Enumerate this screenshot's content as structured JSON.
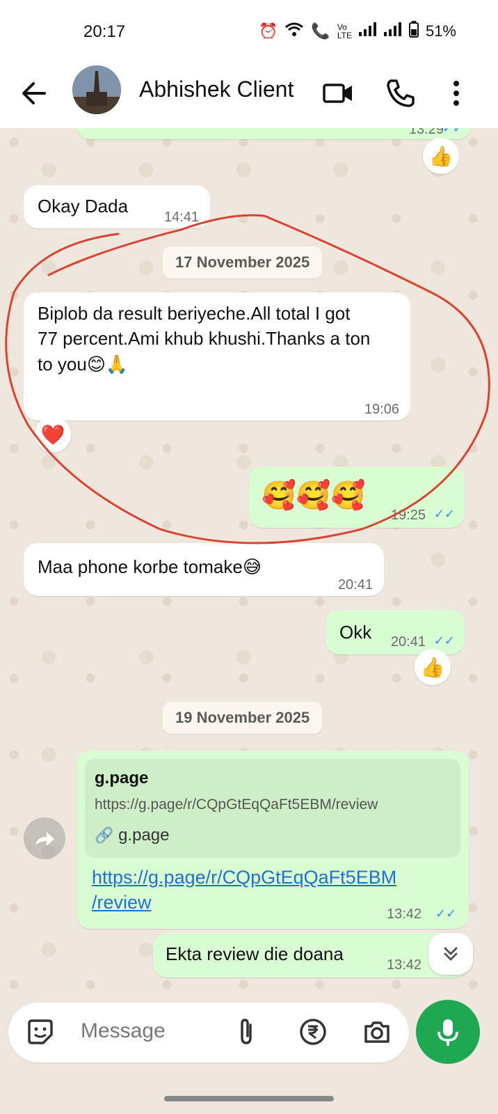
{
  "status_bar": {
    "time": "20:17",
    "battery": "51%"
  },
  "header": {
    "contact_name": "Abhishek Client"
  },
  "messages": [
    {
      "dir": "out",
      "text": "",
      "time": "13:29",
      "reaction": "👍"
    },
    {
      "dir": "in",
      "text": "Okay Dada",
      "time": "14:41"
    },
    {
      "dir": "in",
      "text": "Biplob da result beriyeche.All total I got 77 percent.Ami khub khushi.Thanks a ton to you😊🙏",
      "time": "19:06",
      "reaction": "❤️"
    },
    {
      "dir": "out",
      "text": "🥰🥰🥰",
      "time": "19:25"
    },
    {
      "dir": "in",
      "text": "Maa phone korbe tomake😅",
      "time": "20:41"
    },
    {
      "dir": "out",
      "text": "Okk",
      "time": "20:41",
      "reaction": "👍"
    },
    {
      "dir": "out",
      "text": "Ekta review die doana",
      "time": "13:42"
    }
  ],
  "date_chips": [
    "17 November 2025",
    "19 November 2025"
  ],
  "link_message": {
    "preview_title": "g.page",
    "preview_url": "https://g.page/r/CQpGtEqQaFt5EBM/review",
    "preview_domain": "g.page",
    "url_line1": "https://g.page/r/CQpGtEqQaFt5EBM",
    "url_line2": "/review",
    "time": "13:42"
  },
  "input": {
    "placeholder": "Message"
  },
  "colors": {
    "accent": "#1da851",
    "out_bubble": "#d9fdd3",
    "in_bubble": "#ffffff",
    "annotation": "#d9432f"
  },
  "icons": [
    "back-arrow-icon",
    "video-call-icon",
    "phone-icon",
    "more-vert-icon",
    "sticker-icon",
    "attach-icon",
    "rupee-icon",
    "camera-icon",
    "mic-icon",
    "forward-icon",
    "chevron-double-down-icon"
  ]
}
